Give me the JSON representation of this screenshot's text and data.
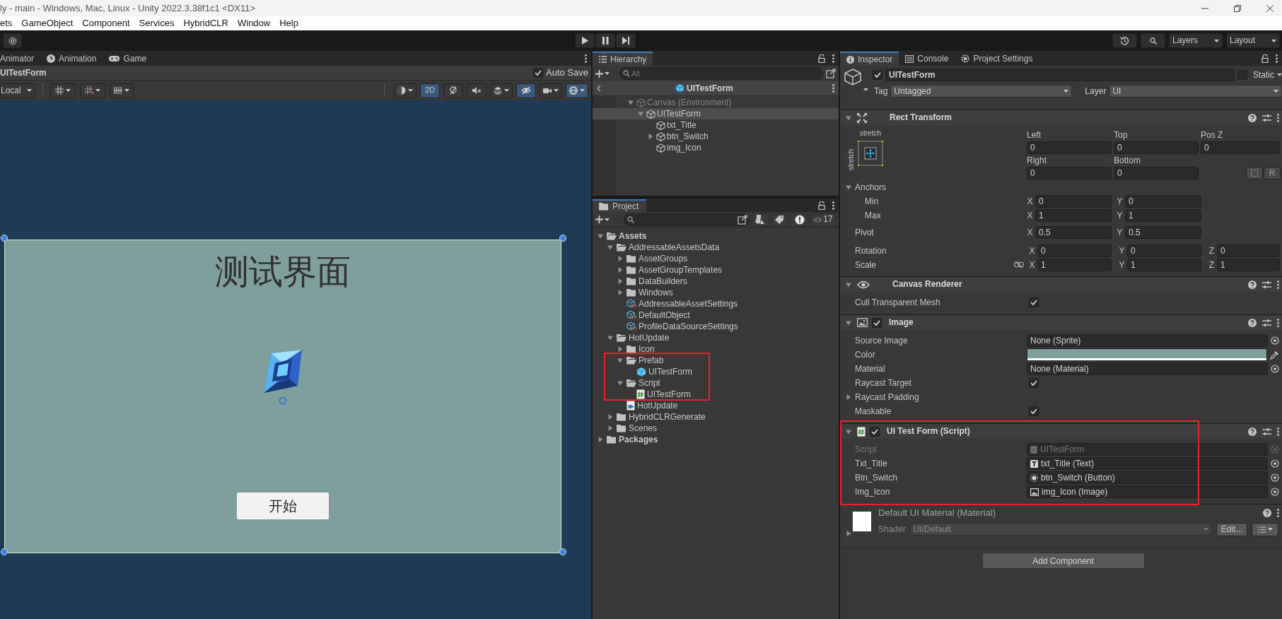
{
  "window": {
    "title": "ly - main - Windows, Mac, Linux - Unity 2022.3.38f1c1 <DX11>"
  },
  "menu": [
    "ets",
    "GameObject",
    "Component",
    "Services",
    "HybridCLR",
    "Window",
    "Help"
  ],
  "toolbar": {
    "layers": "Layers",
    "layout": "Layout"
  },
  "scene": {
    "tabs": [
      {
        "label": "Animator",
        "kind": "animator",
        "selected": false
      },
      {
        "label": "Animation",
        "kind": "animation",
        "selected": false
      },
      {
        "label": "Game",
        "kind": "game",
        "selected": false
      }
    ],
    "prefab": "UITestForm",
    "auto_save": {
      "label": "Auto Save",
      "checked": true
    },
    "pivot_mode": "Local",
    "tools": [
      {
        "kind": "shading",
        "on": false,
        "menu": true
      },
      {
        "kind": "dimension",
        "label": "2D",
        "on": true,
        "menu": false
      },
      {
        "kind": "lighting",
        "on": false,
        "menu": false
      },
      {
        "kind": "audio",
        "on": false,
        "menu": false
      },
      {
        "kind": "effects",
        "on": false,
        "menu": true
      },
      {
        "kind": "visibility",
        "on": true,
        "menu": false
      },
      {
        "kind": "camera",
        "on": false,
        "menu": true
      },
      {
        "kind": "gizmos",
        "on": true,
        "menu": true
      }
    ],
    "canvas": {
      "title": "测试界面",
      "button": "开始",
      "color": "#7f9f9d"
    }
  },
  "hierarchy": {
    "tab": "Hierarchy",
    "search": {
      "placeholder": "All"
    },
    "header": "UITestForm",
    "items": [
      {
        "label": "Canvas (Environment)",
        "dimmed": true,
        "selected": false,
        "expanded": true,
        "children": [
          {
            "label": "UITestForm",
            "dimmed": false,
            "selected": true,
            "expanded": true,
            "children": [
              {
                "label": "txt_Title",
                "dimmed": false,
                "selected": false
              },
              {
                "label": "btn_Switch",
                "dimmed": false,
                "selected": false,
                "expanded": false
              },
              {
                "label": "img_Icon",
                "dimmed": false,
                "selected": false
              }
            ]
          }
        ]
      }
    ]
  },
  "project": {
    "tab": "Project",
    "hidden_count": "17",
    "items": [
      {
        "label": "Assets",
        "kind": "folder",
        "expanded": true,
        "children": [
          {
            "label": "AddressableAssetsData",
            "kind": "folder",
            "expanded": true,
            "children": [
              {
                "label": "AssetGroups",
                "kind": "folder",
                "expanded": false
              },
              {
                "label": "AssetGroupTemplates",
                "kind": "folder",
                "expanded": false
              },
              {
                "label": "DataBuilders",
                "kind": "folder",
                "expanded": false
              },
              {
                "label": "Windows",
                "kind": "folder",
                "expanded": false
              },
              {
                "label": "AddressableAssetSettings",
                "kind": "asset"
              },
              {
                "label": "DefaultObject",
                "kind": "asset"
              },
              {
                "label": "ProfileDataSourceSettings",
                "kind": "asset"
              }
            ]
          },
          {
            "label": "HotUpdate",
            "kind": "folder",
            "expanded": true,
            "children": [
              {
                "label": "Icon",
                "kind": "folder",
                "expanded": false
              },
              {
                "label": "Prefab",
                "kind": "folder",
                "expanded": true,
                "children": [
                  {
                    "label": "UITestForm",
                    "kind": "prefab"
                  }
                ]
              },
              {
                "label": "Script",
                "kind": "folder",
                "expanded": true,
                "children": [
                  {
                    "label": "UITestForm",
                    "kind": "script"
                  }
                ]
              },
              {
                "label": "HotUpdate",
                "kind": "assembly"
              }
            ]
          },
          {
            "label": "HybridCLRGenerate",
            "kind": "folder",
            "expanded": false
          },
          {
            "label": "Scenes",
            "kind": "folder",
            "expanded": false
          }
        ]
      },
      {
        "label": "Packages",
        "kind": "folder",
        "expanded": false
      }
    ]
  },
  "inspector": {
    "tabs": [
      {
        "label": "Inspector",
        "kind": "info",
        "selected": true
      },
      {
        "label": "Console",
        "kind": "console",
        "selected": false
      },
      {
        "label": "Project Settings",
        "kind": "settings",
        "selected": false
      }
    ],
    "object": {
      "active": true,
      "name": "UITestForm",
      "static": {
        "label": "Static",
        "checked": false
      },
      "tag_label": "Tag",
      "tag": "Untagged",
      "layer_label": "Layer",
      "layer": "UI"
    },
    "components": [
      {
        "kind": "transform",
        "title": "Rect Transform",
        "expanded": true,
        "preset_h": "stretch",
        "preset_v": "stretch",
        "raw_edit": "R",
        "offsets": [
          {
            "label": "Left",
            "value": "0"
          },
          {
            "label": "Top",
            "value": "0"
          },
          {
            "label": "Pos Z",
            "value": "0"
          },
          {
            "label": "Right",
            "value": "0"
          },
          {
            "label": "Bottom",
            "value": "0"
          }
        ],
        "rows": [
          {
            "kind": "foldout",
            "label": "Anchors",
            "expanded": true,
            "children": [
              {
                "kind": "vector",
                "label": "Min",
                "axes": [
                  {
                    "axis": "X",
                    "value": "0"
                  },
                  {
                    "axis": "Y",
                    "value": "0"
                  }
                ]
              },
              {
                "kind": "vector",
                "label": "Max",
                "axes": [
                  {
                    "axis": "X",
                    "value": "1"
                  },
                  {
                    "axis": "Y",
                    "value": "1"
                  }
                ]
              }
            ]
          },
          {
            "kind": "vector",
            "label": "Pivot",
            "axes": [
              {
                "axis": "X",
                "value": "0.5"
              },
              {
                "axis": "Y",
                "value": "0.5"
              }
            ]
          },
          {
            "kind": "vector",
            "label": "Rotation",
            "axes": [
              {
                "axis": "X",
                "value": "0"
              },
              {
                "axis": "Y",
                "value": "0"
              },
              {
                "axis": "Z",
                "value": "0"
              }
            ]
          },
          {
            "kind": "vector",
            "label": "Scale",
            "constrained": false,
            "axes": [
              {
                "axis": "X",
                "value": "1"
              },
              {
                "axis": "Y",
                "value": "1"
              },
              {
                "axis": "Z",
                "value": "1"
              }
            ]
          }
        ]
      },
      {
        "kind": "renderer",
        "title": "Canvas Renderer",
        "expanded": true,
        "rows": [
          {
            "kind": "toggle",
            "label": "Cull Transparent Mesh",
            "checked": true
          }
        ]
      },
      {
        "kind": "image",
        "title": "Image",
        "enabled": true,
        "expanded": true,
        "rows": [
          {
            "kind": "object",
            "label": "Source Image",
            "value": "None (Sprite)",
            "disabled": false
          },
          {
            "kind": "color",
            "label": "Color",
            "color": "#7f9f9d",
            "level": 1
          },
          {
            "kind": "object",
            "label": "Material",
            "value": "None (Material)",
            "disabled": false
          },
          {
            "kind": "toggle",
            "label": "Raycast Target",
            "checked": true
          },
          {
            "kind": "foldout",
            "label": "Raycast Padding",
            "expanded": false
          },
          {
            "kind": "toggle",
            "label": "Maskable",
            "checked": true
          }
        ]
      },
      {
        "kind": "script",
        "title": "UI Test Form (Script)",
        "enabled": true,
        "expanded": true,
        "rows": [
          {
            "kind": "script",
            "label": "Script",
            "value": "UITestForm",
            "disabled": true
          },
          {
            "kind": "text",
            "label": "Txt_Title",
            "value": "txt_Title (Text)",
            "disabled": false
          },
          {
            "kind": "button",
            "label": "Btn_Switch",
            "value": "btn_Switch (Button)",
            "disabled": false
          },
          {
            "kind": "image",
            "label": "Img_Icon",
            "value": "img_Icon (Image)",
            "disabled": false
          }
        ]
      },
      {
        "kind": "material",
        "title": "Default UI Material (Material)",
        "expanded": false,
        "shader_label": "Shader",
        "shader": "UI/Default",
        "edit": "Edit..."
      }
    ],
    "add_component": "Add Component"
  }
}
